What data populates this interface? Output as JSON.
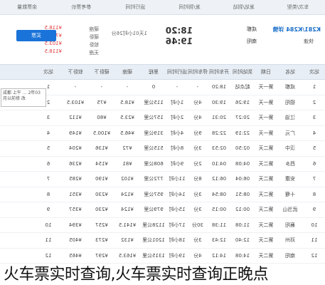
{
  "header": {
    "columns": [
      "车次/类型",
      "发站/到站",
      "发/到时间",
      "运行时间",
      "参考票价",
      "余票数量"
    ]
  },
  "train": {
    "number": "K281/K284 详情",
    "type": "快速",
    "depart_station": "成都",
    "arrive_station": "南阳",
    "depart_time": "18:20",
    "arrive_time": "19:46",
    "duration": "1天01小时26分",
    "seats": [
      "硬座",
      "硬卧",
      "软卧",
      "无座"
    ],
    "prices": [
      "¥118.5",
      "¥75",
      "¥103.5",
      "¥118.5"
    ],
    "buy_label": "买票"
  },
  "stations": {
    "columns": [
      "站次",
      "站名",
      "日期",
      "到站时间",
      "开车时间",
      "停车时间",
      "运行时间",
      "里程",
      "硬座",
      "硬卧下",
      "软卧下",
      "站次"
    ],
    "rows": [
      [
        "1",
        "成都",
        "第一天",
        "起点站",
        "18:20",
        "-",
        "-",
        "0",
        "-",
        "-",
        "-",
        "1"
      ],
      [
        "2",
        "德阳",
        "第一天",
        "19:26",
        "19:30",
        "4分",
        "1小时",
        "115公里",
        "¥18.5",
        "¥75",
        "¥103.5",
        "2"
      ],
      [
        "3",
        "江油",
        "第一天",
        "20:27",
        "20:31",
        "4分",
        "2小时",
        "157公里",
        "¥23.5",
        "¥80",
        "¥112",
        "3"
      ],
      [
        "4",
        "广元",
        "第一天",
        "22:19",
        "22:28",
        "9分",
        "4小时",
        "319公里",
        "¥46.5",
        "¥100.5",
        "¥149",
        "4"
      ],
      [
        "5",
        "汉中",
        "第二天",
        "02:50",
        "02:53",
        "3分",
        "8小时",
        "515公里",
        "¥72",
        "¥136",
        "¥204",
        "5"
      ],
      [
        "6",
        "西乡",
        "第二天",
        "04:08",
        "04:10",
        "2分",
        "9小时",
        "608公里",
        "¥81",
        "¥154",
        "¥236",
        "6"
      ],
      [
        "7",
        "安康",
        "第二天",
        "06:04",
        "06:12",
        "8分",
        "11小时",
        "772公里",
        "¥102",
        "¥190",
        "¥285",
        "7"
      ],
      [
        "8",
        "十堰",
        "第二天",
        "08:51",
        "08:54",
        "3分",
        "14小时",
        "957公里",
        "¥124",
        "¥230",
        "¥351",
        "8"
      ],
      [
        "9",
        "武当山",
        "第二天",
        "00:12",
        "00:15",
        "3分",
        "15小时",
        "979公里",
        "¥124",
        "¥230",
        "¥357",
        "9"
      ],
      [
        "10",
        "襄阳",
        "第二天",
        "11:08",
        "11:38",
        "30分",
        "17小时",
        "1128公里",
        "¥141.5",
        "¥257",
        "¥394",
        "10"
      ],
      [
        "11",
        "邓州",
        "第二天",
        "12:40",
        "12:43",
        "3分",
        "18小时",
        "1201公里",
        "¥132",
        "¥273",
        "¥405",
        "11"
      ],
      [
        "12",
        "南阳",
        "第二天",
        "14:08",
        "14:12",
        "4分",
        "19小时",
        "1315公里",
        "¥163.5",
        "¥297",
        "¥465",
        "12"
      ]
    ]
  },
  "tooltip": "成都 上午 ... 2年03月以前修 改",
  "caption": "火车票实时查询,火车票实时查询正晚点"
}
